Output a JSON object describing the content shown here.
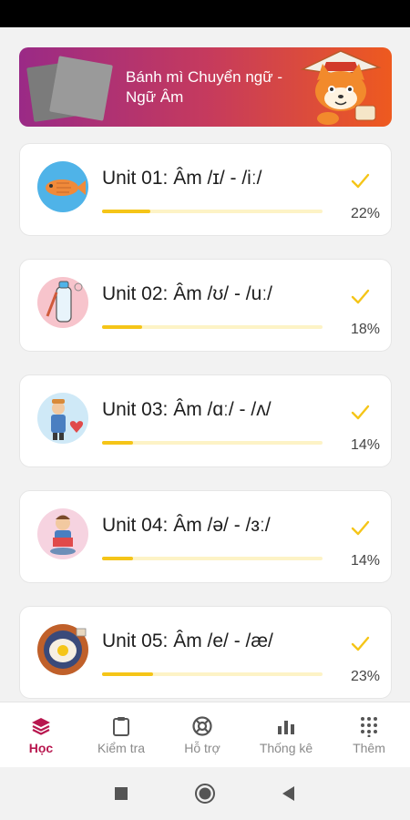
{
  "banner": {
    "title": "Bánh mì Chuyển ngữ - Ngữ Âm",
    "thumb_icon": "image-placeholder-icon",
    "mascot_icon": "fox-mascot-icon"
  },
  "units": [
    {
      "title": "Unit 01: Âm /ɪ/ - /iː/",
      "progress": 0.22,
      "percent": "22%",
      "icon": "fish-illustration-icon",
      "completed": true
    },
    {
      "title": "Unit 02: Âm /ʊ/ - /uː/",
      "progress": 0.18,
      "percent": "18%",
      "icon": "bottle-illustration-icon",
      "completed": true
    },
    {
      "title": "Unit 03: Âm /ɑː/ - /ʌ/",
      "progress": 0.14,
      "percent": "14%",
      "icon": "cook-illustration-icon",
      "completed": true
    },
    {
      "title": "Unit 04: Âm /ə/ - /ɜː/",
      "progress": 0.14,
      "percent": "14%",
      "icon": "reader-illustration-icon",
      "completed": true
    },
    {
      "title": "Unit 05: Âm /e/ - /æ/",
      "progress": 0.23,
      "percent": "23%",
      "icon": "egg-illustration-icon",
      "completed": true
    }
  ],
  "tabs": [
    {
      "label": "Học",
      "icon": "layers-icon",
      "active": true
    },
    {
      "label": "Kiểm tra",
      "icon": "clipboard-icon",
      "active": false
    },
    {
      "label": "Hỗ trợ",
      "icon": "lifebuoy-icon",
      "active": false
    },
    {
      "label": "Thống kê",
      "icon": "bar-chart-icon",
      "active": false
    },
    {
      "label": "Thêm",
      "icon": "grid-dots-icon",
      "active": false
    }
  ],
  "colors": {
    "accent": "#b8174f",
    "progress": "#f5c518",
    "progress_track": "#fdf3c6",
    "check": "#f5c518",
    "banner_start": "#9a2a86",
    "banner_end": "#ee5a1f"
  }
}
